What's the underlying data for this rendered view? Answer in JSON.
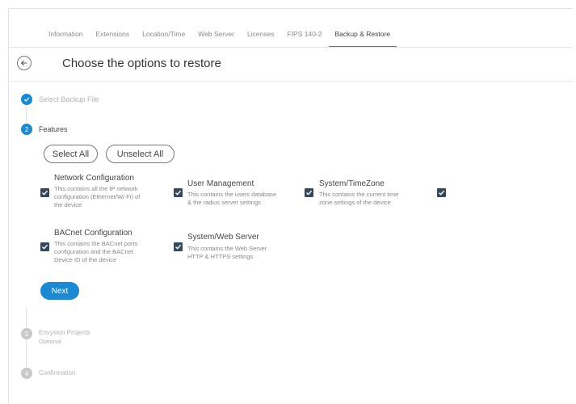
{
  "tabs": [
    "Information",
    "Extensions",
    "Location/Time",
    "Web Server",
    "Licenses",
    "FIPS 140-2",
    "Backup & Restore"
  ],
  "active_tab": "Backup & Restore",
  "header": {
    "title": "Choose the options to restore"
  },
  "steps": [
    {
      "number": "1",
      "label": "Select Backup File",
      "state": "done"
    },
    {
      "number": "2",
      "label": "Features",
      "state": "active"
    },
    {
      "number": "3",
      "label": "Envysion Projects",
      "sublabel": "Optional",
      "state": "pending"
    },
    {
      "number": "4",
      "label": "Confirmation",
      "state": "pending"
    }
  ],
  "buttons": {
    "select_all": "Select All",
    "unselect_all": "Unselect All",
    "next": "Next"
  },
  "features": [
    {
      "title": "Network Configuration",
      "desc1": "This contains all the IP network",
      "desc2": "configuration (Ethernet/Wi-Fi) of",
      "desc3": "the device",
      "checked": true
    },
    {
      "title": "User Management",
      "desc1": "This contains the users database",
      "desc2": "& the radius server settings",
      "desc3": "",
      "checked": true
    },
    {
      "title": "System/TimeZone",
      "desc1": "This contains the current time",
      "desc2": "zone settings of the device",
      "desc3": "",
      "checked": true
    },
    {
      "title": "",
      "desc1": "",
      "desc2": "",
      "desc3": "",
      "checked": true
    },
    {
      "title": "BACnet Configuration",
      "desc1": "This contains the BACnet ports",
      "desc2": "configuration and the BACnet",
      "desc3": "Device ID of the device",
      "checked": true
    },
    {
      "title": "System/Web Server",
      "desc1": "This contains the Web Server",
      "desc2": "HTTP & HTTPS settings",
      "desc3": "",
      "checked": true
    }
  ],
  "colors": {
    "accent": "#1a8ad4",
    "checkbox": "#34495e",
    "muted": "#b4b4b4"
  }
}
